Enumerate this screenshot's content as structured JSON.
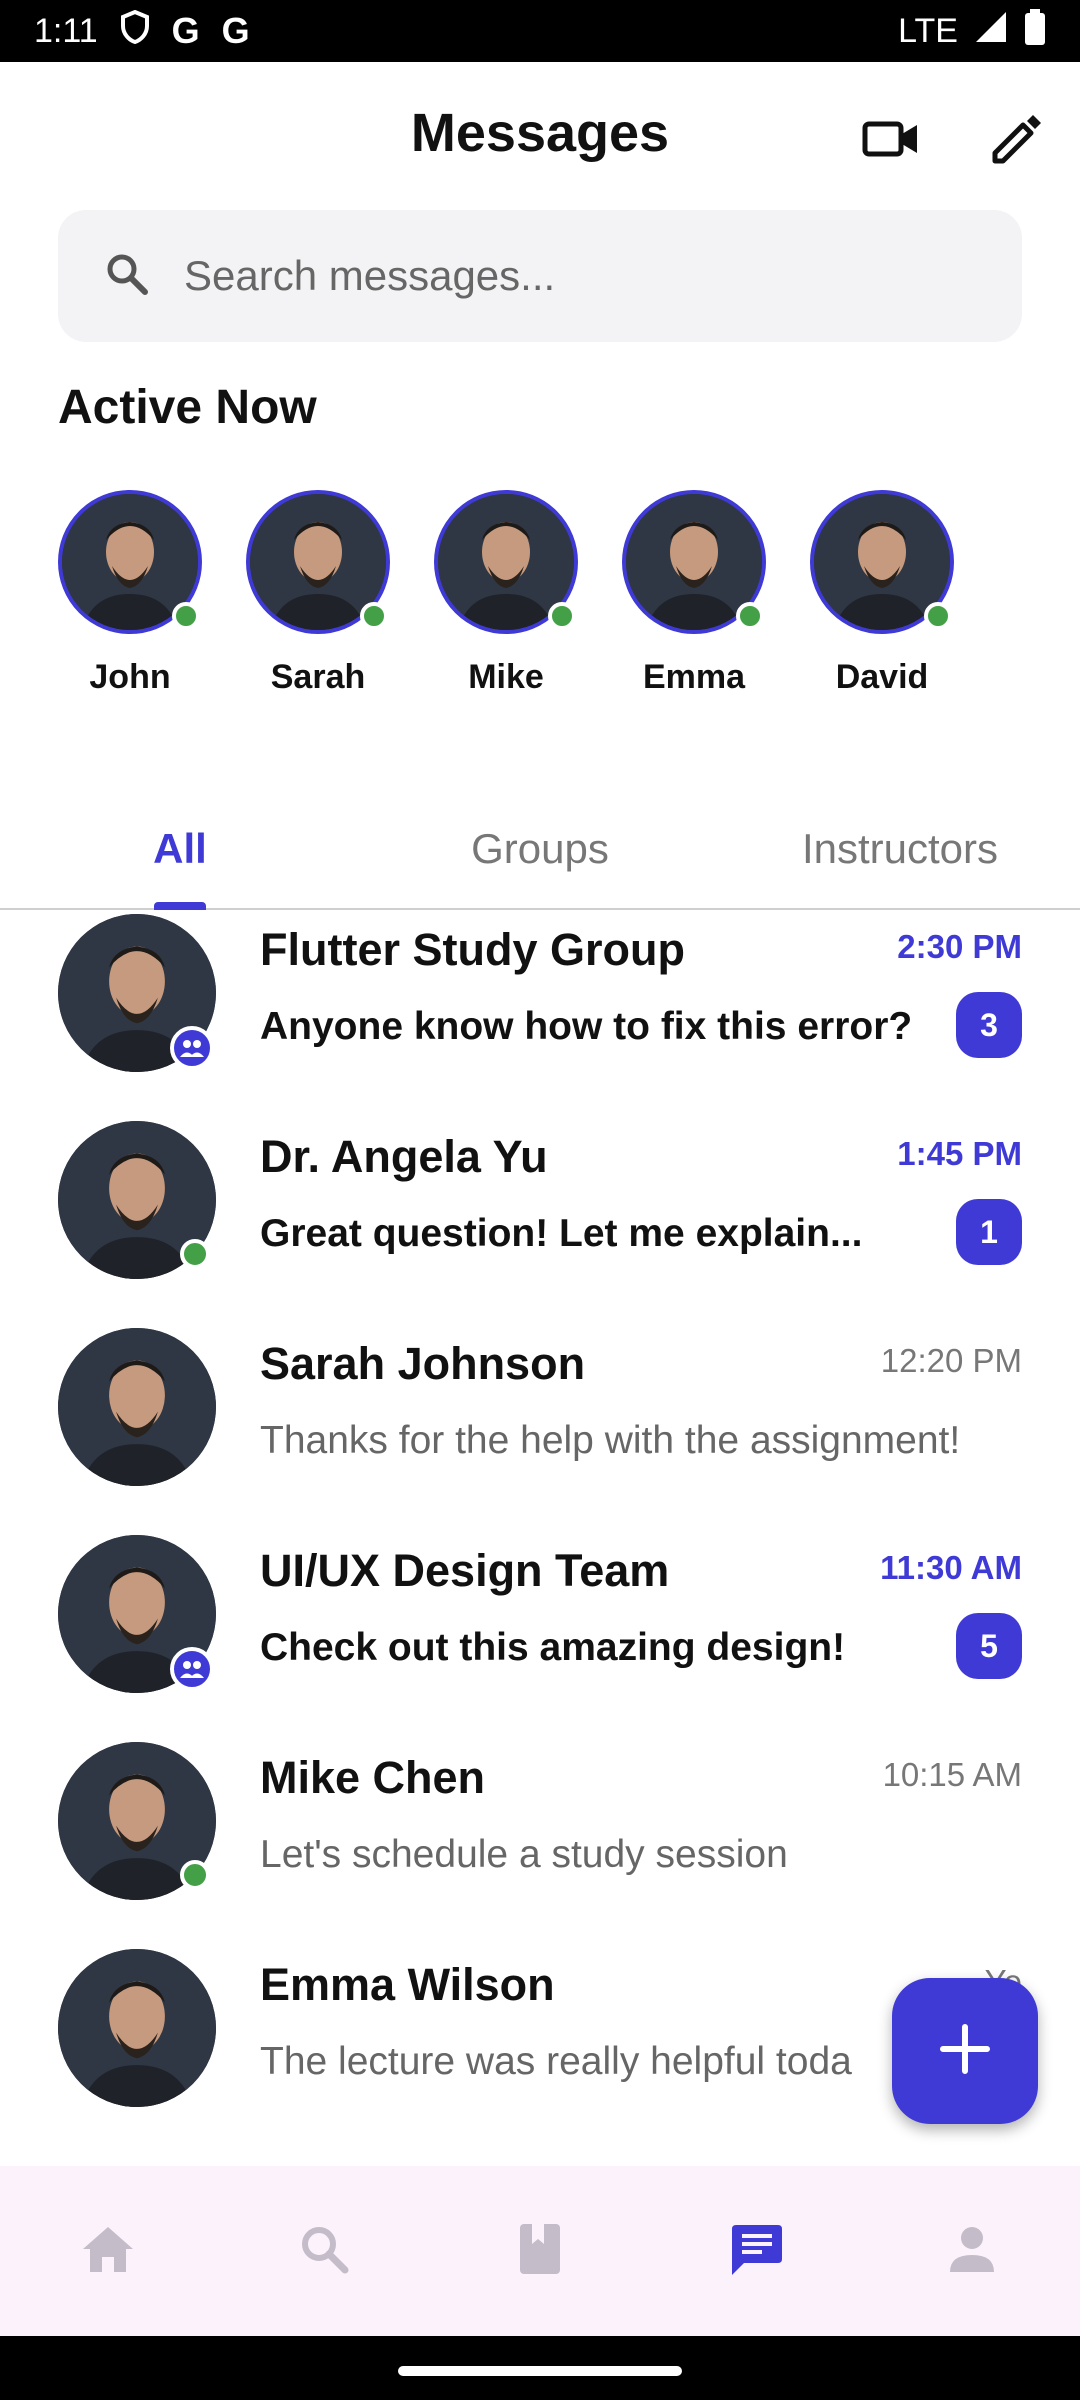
{
  "status_bar": {
    "time": "1:11",
    "network": "LTE",
    "notif_icons": [
      "shield-icon",
      "G",
      "G"
    ]
  },
  "header": {
    "title": "Messages",
    "video_icon": "video-call-icon",
    "compose_icon": "edit-icon"
  },
  "search": {
    "placeholder": "Search messages..."
  },
  "active_now": {
    "title": "Active Now",
    "users": [
      {
        "name": "John"
      },
      {
        "name": "Sarah"
      },
      {
        "name": "Mike"
      },
      {
        "name": "Emma"
      },
      {
        "name": "David"
      }
    ]
  },
  "tabs": [
    {
      "label": "All",
      "selected": true
    },
    {
      "label": "Groups",
      "selected": false
    },
    {
      "label": "Instructors",
      "selected": false
    }
  ],
  "conversations": [
    {
      "name": "Flutter Study Group",
      "time": "2:30 PM",
      "preview": "Anyone know how to fix this error?",
      "unread": "3",
      "type": "group"
    },
    {
      "name": "Dr. Angela Yu",
      "time": "1:45 PM",
      "preview": "Great question! Let me explain...",
      "unread": "1",
      "type": "online"
    },
    {
      "name": "Sarah Johnson",
      "time": "12:20 PM",
      "preview": "Thanks for the help with the assignment!",
      "unread": "",
      "type": "none"
    },
    {
      "name": "UI/UX Design Team",
      "time": "11:30 AM",
      "preview": "Check out this amazing design!",
      "unread": "5",
      "type": "group"
    },
    {
      "name": "Mike Chen",
      "time": "10:15 AM",
      "preview": "Let's schedule a study session",
      "unread": "",
      "type": "online"
    },
    {
      "name": "Emma Wilson",
      "time": "Ye",
      "preview": "The lecture was really helpful toda",
      "unread": "",
      "type": "none"
    }
  ],
  "fab": {
    "icon": "plus-icon"
  },
  "bottom_nav": [
    {
      "icon": "home-icon",
      "selected": false
    },
    {
      "icon": "search-icon",
      "selected": false
    },
    {
      "icon": "book-icon",
      "selected": false
    },
    {
      "icon": "chat-icon",
      "selected": true
    },
    {
      "icon": "person-icon",
      "selected": false
    }
  ],
  "colors": {
    "accent": "#3f3ad6",
    "online": "#43a047",
    "nav_bg": "#fbf2fb"
  }
}
